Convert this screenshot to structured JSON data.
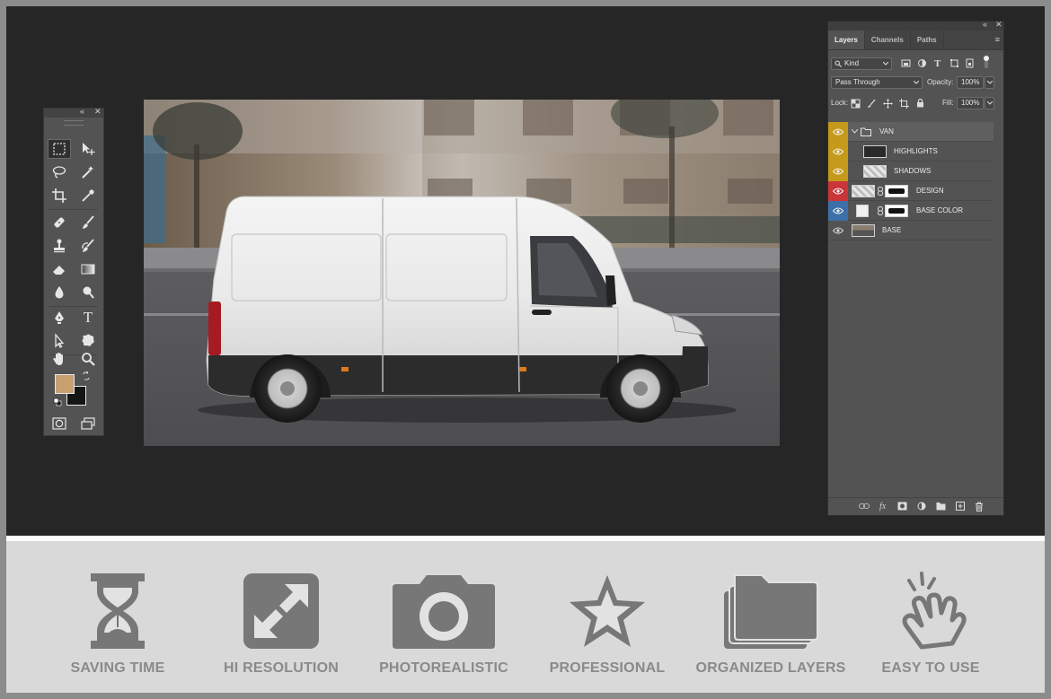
{
  "toolbar": {
    "collapse_glyph": "«",
    "close_glyph": "✕",
    "tools": [
      {
        "name": "rectangular-marquee-icon",
        "active": true
      },
      {
        "name": "move-icon"
      },
      {
        "name": "lasso-icon"
      },
      {
        "name": "magic-wand-icon"
      },
      {
        "name": "crop-icon"
      },
      {
        "name": "eyedropper-icon"
      },
      {
        "name": "healing-brush-icon"
      },
      {
        "name": "brush-icon"
      },
      {
        "name": "clone-stamp-icon"
      },
      {
        "name": "history-brush-icon"
      },
      {
        "name": "eraser-icon"
      },
      {
        "name": "gradient-icon"
      },
      {
        "name": "blur-icon"
      },
      {
        "name": "dodge-icon"
      },
      {
        "name": "pen-icon"
      },
      {
        "name": "type-icon",
        "text": "T"
      },
      {
        "name": "path-selection-icon"
      },
      {
        "name": "custom-shape-icon"
      },
      {
        "name": "hand-icon"
      },
      {
        "name": "zoom-icon"
      }
    ],
    "foreground_color": "#c8a070",
    "background_color": "#151515"
  },
  "layers_panel": {
    "collapse_glyph": "«",
    "close_glyph": "✕",
    "tabs": [
      "Layers",
      "Channels",
      "Paths"
    ],
    "active_tab": "Layers",
    "menu_glyph": "≡",
    "filter_kind": "Kind",
    "blend_mode": "Pass Through",
    "opacity_label": "Opacity:",
    "opacity_value": "100%",
    "lock_label": "Lock:",
    "fill_label": "Fill:",
    "fill_value": "100%",
    "layers": [
      {
        "name": "VAN",
        "type": "group",
        "eye_color": "#c59a1a"
      },
      {
        "name": "HIGHLIGHTS",
        "eye_color": "#c59a1a"
      },
      {
        "name": "SHADOWS",
        "eye_color": "#c59a1a"
      },
      {
        "name": "DESIGN",
        "eye_color": "#c8363a"
      },
      {
        "name": "BASE COLOR",
        "eye_color": "#3d6fa8"
      },
      {
        "name": "BASE",
        "eye_color": "none"
      }
    ]
  },
  "features": [
    {
      "label": "SAVING TIME",
      "icon": "hourglass-icon"
    },
    {
      "label": "HI RESOLUTION",
      "icon": "expand-arrows-icon"
    },
    {
      "label": "PHOTOREALISTIC",
      "icon": "camera-icon"
    },
    {
      "label": "PROFESSIONAL",
      "icon": "star-icon"
    },
    {
      "label": "ORGANIZED LAYERS",
      "icon": "folders-icon"
    },
    {
      "label": "EASY TO USE",
      "icon": "pointing-hand-icon"
    }
  ],
  "colors": {
    "workspace": "#262626",
    "panel": "#535353",
    "feature_icon": "#777777",
    "feature_text": "#8a8a8a"
  }
}
